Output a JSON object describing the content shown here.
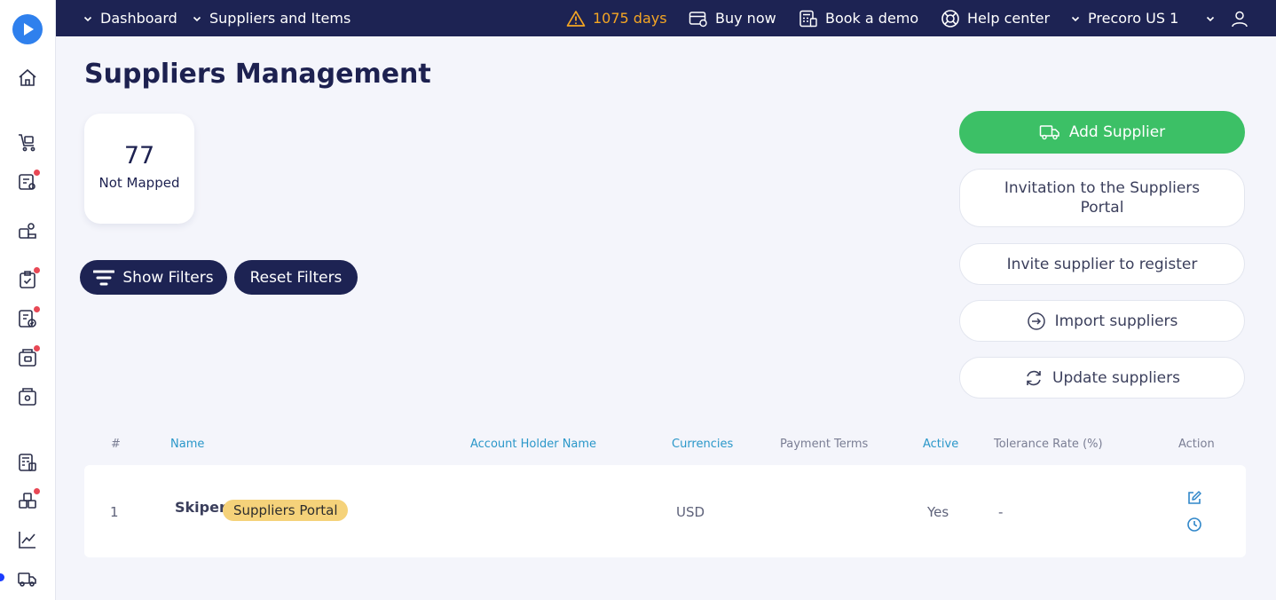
{
  "topbar": {
    "nav1": "Dashboard",
    "nav2": "Suppliers and Items",
    "trial": "1075 days",
    "buy": "Buy now",
    "demo": "Book a demo",
    "help": "Help center",
    "company": "Precoro US 1"
  },
  "page": {
    "title": "Suppliers Management",
    "stat_value": "77",
    "stat_label": "Not Mapped"
  },
  "filters": {
    "show": "Show Filters",
    "reset": "Reset Filters"
  },
  "actions": {
    "add": "Add Supplier",
    "invitation": "Invitation to the Suppliers Portal",
    "invite": "Invite supplier to register",
    "import": "Import suppliers",
    "update": "Update suppliers"
  },
  "table": {
    "headers": {
      "num": "#",
      "name": "Name",
      "account": "Account Holder Name",
      "currencies": "Currencies",
      "terms": "Payment Terms",
      "active": "Active",
      "tolerance": "Tolerance Rate (%)",
      "action": "Action"
    },
    "rows": [
      {
        "num": "1",
        "name": "Skiper",
        "badge": "Suppliers Portal",
        "currency": "USD",
        "active": "Yes",
        "tolerance": "-"
      }
    ]
  },
  "colors": {
    "navy": "#1d2353",
    "green": "#3cc066",
    "link": "#2a97c9",
    "badge": "#f5d27a",
    "warning": "#f5a623"
  }
}
